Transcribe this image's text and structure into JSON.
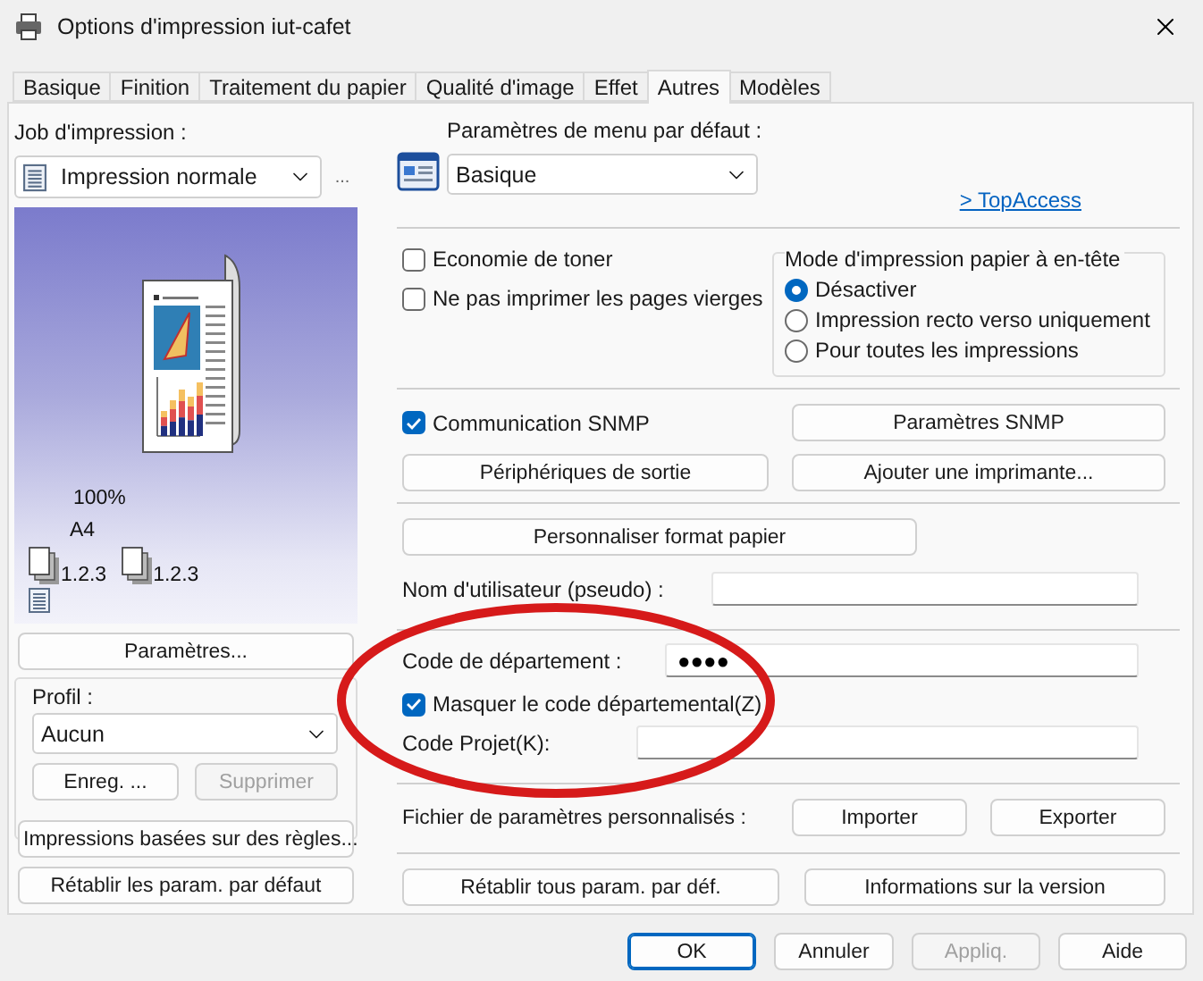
{
  "window": {
    "title": "Options d'impression iut-cafet"
  },
  "tabs": [
    {
      "label": "Basique",
      "selected": false
    },
    {
      "label": "Finition",
      "selected": false
    },
    {
      "label": "Traitement du papier",
      "selected": false
    },
    {
      "label": "Qualité d'image",
      "selected": false
    },
    {
      "label": "Effet",
      "selected": false
    },
    {
      "label": "Autres",
      "selected": true
    },
    {
      "label": "Modèles",
      "selected": false
    }
  ],
  "job": {
    "label": "Job d'impression :",
    "value": "Impression normale",
    "more_button": "..."
  },
  "preview": {
    "scale": "100%",
    "paper": "A4",
    "collate": [
      "1.2.3",
      "1.2.3"
    ]
  },
  "settings_button": "Paramètres...",
  "profile": {
    "label": "Profil :",
    "value": "Aucun",
    "buttons": [
      {
        "label": "Enreg. ...",
        "disabled": false
      },
      {
        "label": "Supprimer",
        "disabled": true
      }
    ]
  },
  "left_buttons": [
    "Impressions basées sur des règles...",
    "Rétablir les param. par défaut"
  ],
  "menu_defaults": {
    "label": "Paramètres de menu par défaut :",
    "value": "Basique"
  },
  "link": "> TopAccess",
  "options": [
    {
      "label": "Economie de toner",
      "checked": false
    },
    {
      "label": "Ne pas imprimer les pages vierges",
      "checked": false
    }
  ],
  "letterhead": {
    "title": "Mode d'impression papier à en-tête",
    "options": [
      {
        "label": "Désactiver",
        "selected": true
      },
      {
        "label": "Impression recto verso uniquement",
        "selected": false
      },
      {
        "label": "Pour toutes les impressions",
        "selected": false
      }
    ]
  },
  "snmp": {
    "label": "Communication SNMP",
    "checked": true,
    "button": "Paramètres SNMP"
  },
  "device_buttons": [
    "Périphériques de sortie",
    "Ajouter une imprimante..."
  ],
  "paper_button": "Personnaliser format papier",
  "user_field": {
    "label": "Nom d'utilisateur (pseudo) :"
  },
  "department": {
    "label": "Code de département :",
    "value": "●●●●",
    "mask": {
      "label": "Masquer le code départemental(Z)",
      "checked": true
    }
  },
  "project": {
    "label": "Code Projet(K):"
  },
  "custom_file": {
    "label": "Fichier de paramètres personnalisés :",
    "buttons": [
      "Importer",
      "Exporter"
    ]
  },
  "reset_buttons": [
    "Rétablir tous param. par déf.",
    "Informations sur la version"
  ],
  "dialog_buttons": [
    {
      "label": "OK",
      "default": true,
      "disabled": false
    },
    {
      "label": "Annuler",
      "default": false,
      "disabled": false
    },
    {
      "label": "Appliq.",
      "default": false,
      "disabled": true
    },
    {
      "label": "Aide",
      "default": false,
      "disabled": false
    }
  ]
}
